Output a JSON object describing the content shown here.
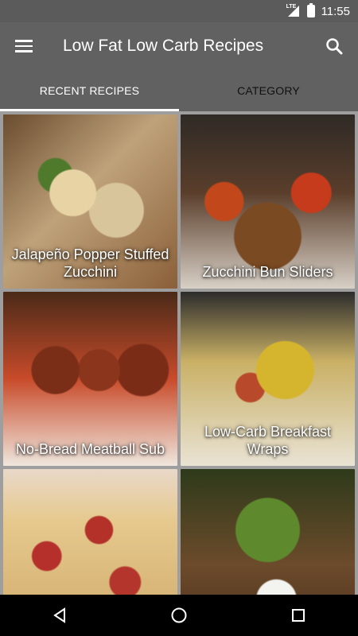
{
  "status_bar": {
    "time": "11:55",
    "network_label": "LTE",
    "icons": [
      "signal-icon",
      "battery-icon"
    ]
  },
  "app_bar": {
    "title": "Low Fat Low Carb Recipes",
    "menu_icon": "menu-icon",
    "search_icon": "search-icon"
  },
  "tabs": [
    {
      "label": "RECENT RECIPES",
      "active": true
    },
    {
      "label": "CATEGORY",
      "active": false
    }
  ],
  "recipes": [
    {
      "title": "Jalapeño Popper Stuffed Zucchini"
    },
    {
      "title": "Zucchini Bun Sliders"
    },
    {
      "title": "No-Bread Meatball Sub"
    },
    {
      "title": "Low-Carb Breakfast Wraps"
    },
    {
      "title": ""
    },
    {
      "title": ""
    }
  ],
  "nav_bar": {
    "icons": [
      "back-icon",
      "home-icon",
      "recents-icon"
    ]
  }
}
